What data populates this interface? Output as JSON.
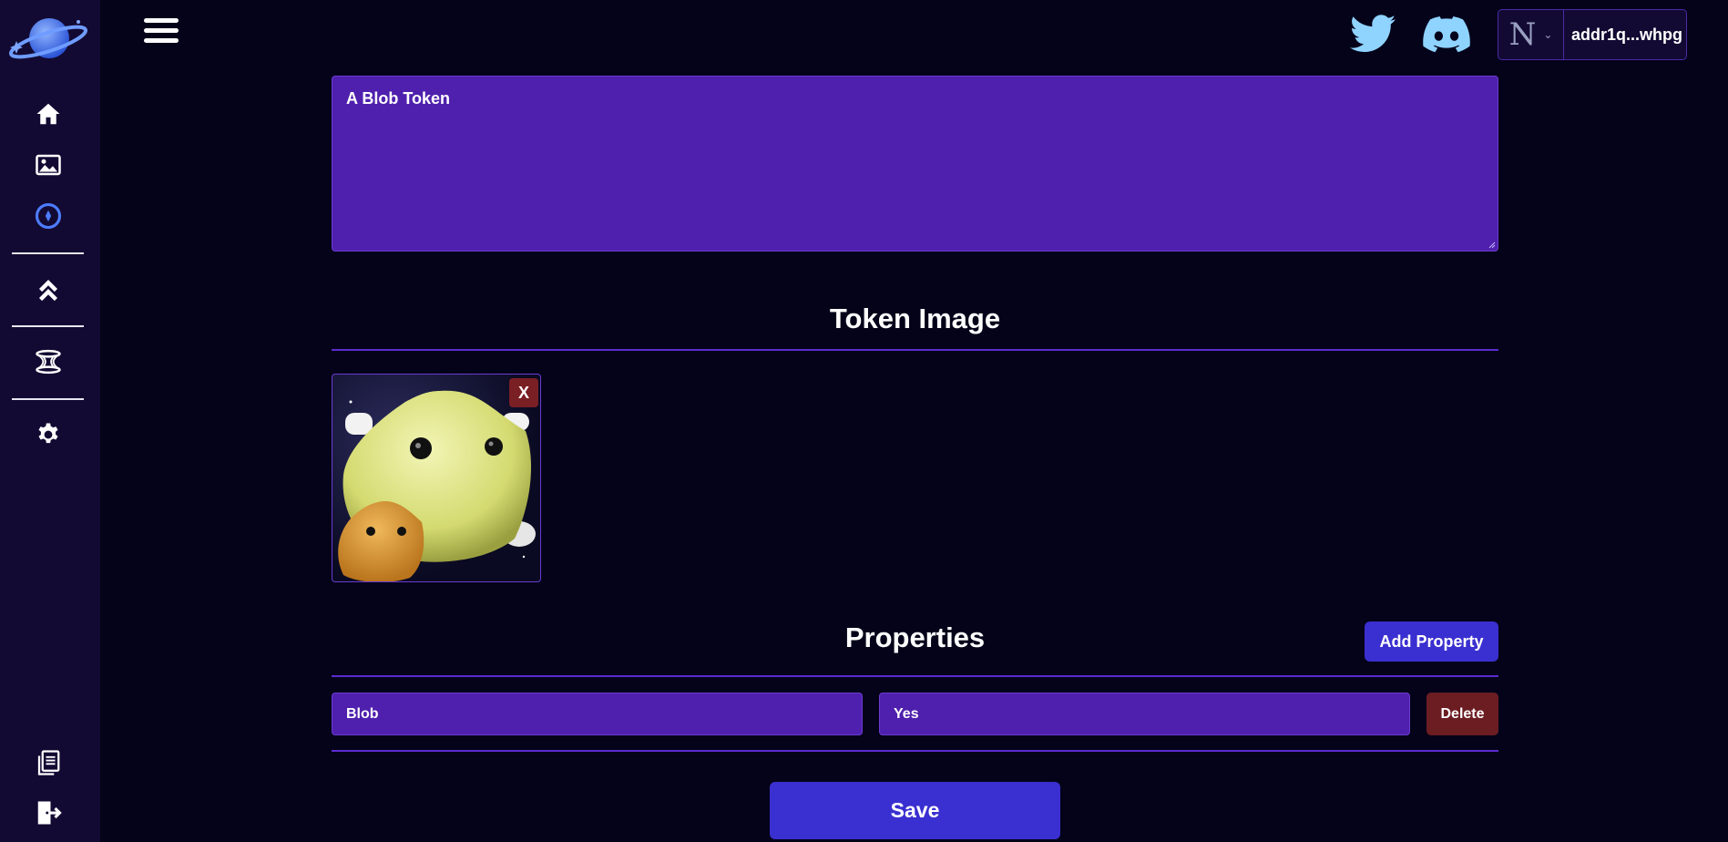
{
  "header": {
    "menu_icon": "hamburger-icon",
    "social": [
      {
        "name": "twitter-icon",
        "color": "#8fd3ff"
      },
      {
        "name": "discord-icon",
        "color": "#8fd3ff"
      }
    ],
    "wallet": {
      "network_glyph": "N",
      "address": "addr1q...whpg"
    }
  },
  "sidebar": {
    "items": [
      {
        "icon": "home-icon"
      },
      {
        "icon": "image-icon"
      },
      {
        "icon": "compass-icon",
        "active": true
      },
      {
        "icon": "chevrons-up-icon"
      },
      {
        "icon": "portal-icon"
      },
      {
        "icon": "gear-icon"
      },
      {
        "icon": "documents-icon"
      },
      {
        "icon": "logout-icon"
      }
    ],
    "active_color": "#4d7cff"
  },
  "form": {
    "description": "A Blob Token",
    "token_image_title": "Token Image",
    "remove_image_label": "X",
    "properties_title": "Properties",
    "add_property_label": "Add Property",
    "properties": [
      {
        "key": "Blob",
        "value": "Yes",
        "delete_label": "Delete"
      }
    ],
    "save_label": "Save"
  },
  "colors": {
    "background": "#05031a",
    "sidebar": "#130a33",
    "input_fill": "#4f20ad",
    "accent_button": "#3a2fd0",
    "danger": "#6b1d22",
    "divider": "#5b2bd0"
  }
}
